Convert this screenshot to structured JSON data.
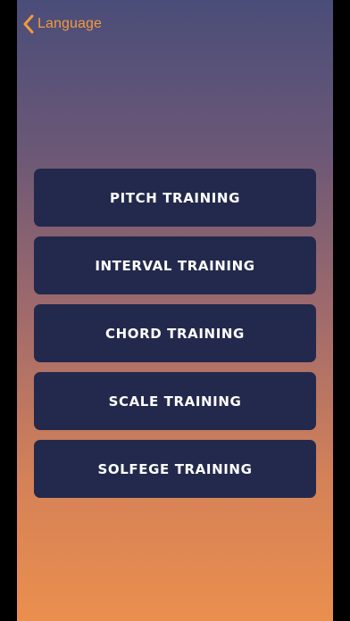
{
  "nav": {
    "back_label": "Language",
    "back_icon": "chevron-left-icon"
  },
  "colors": {
    "accent": "#f19a3e",
    "button_bg": "#23294c",
    "gradient_top": "#4a4d79",
    "gradient_bottom": "#ea8f4e"
  },
  "menu": {
    "items": [
      {
        "label": "PITCH TRAINING"
      },
      {
        "label": "INTERVAL TRAINING"
      },
      {
        "label": "CHORD TRAINING"
      },
      {
        "label": "SCALE TRAINING"
      },
      {
        "label": "SOLFEGE TRAINING"
      }
    ]
  }
}
